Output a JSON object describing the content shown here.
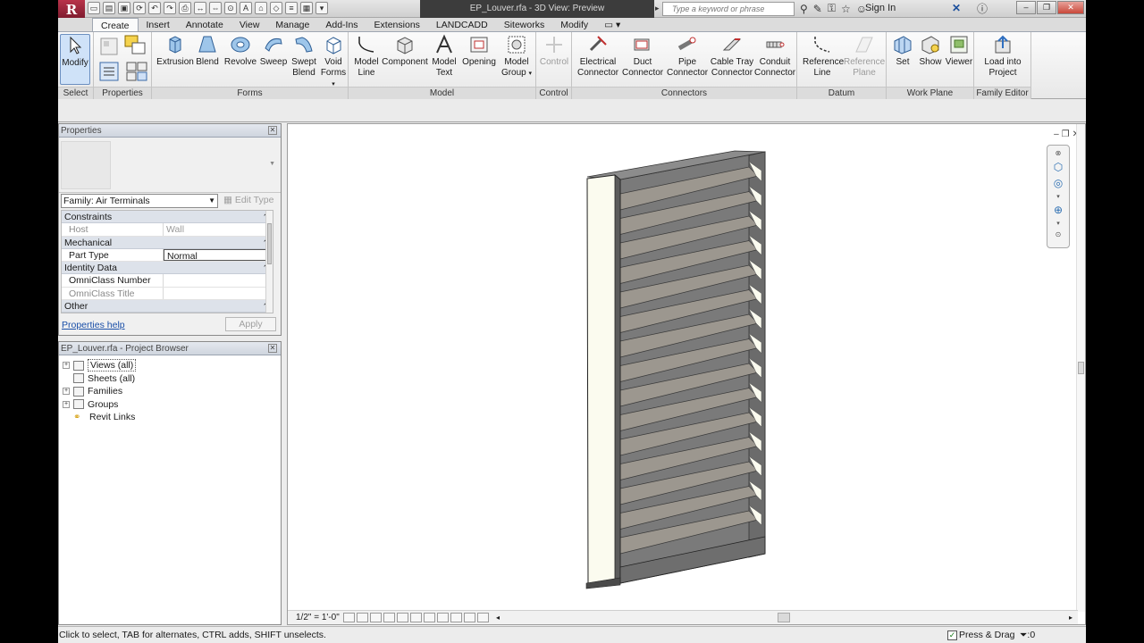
{
  "titlebar": {
    "app_menu_letter": "R",
    "doc_title": "EP_Louver.rfa - 3D View: Preview",
    "search_placeholder": "Type a keyword or phrase",
    "sign_in": "Sign In"
  },
  "ribbon": {
    "tabs": [
      "Create",
      "Insert",
      "Annotate",
      "View",
      "Manage",
      "Add-Ins",
      "Extensions",
      "LANDCADD",
      "Siteworks",
      "Modify"
    ],
    "panels": {
      "select": "Select",
      "properties": "Properties",
      "forms": "Forms",
      "model": "Model",
      "control": "Control",
      "connectors": "Connectors",
      "datum": "Datum",
      "work_plane": "Work Plane",
      "family_editor": "Family Editor"
    },
    "tools": {
      "modify": "Modify",
      "extrusion": "Extrusion",
      "blend": "Blend",
      "revolve": "Revolve",
      "sweep": "Sweep",
      "swept_blend_1": "Swept",
      "swept_blend_2": "Blend",
      "void_forms_1": "Void",
      "void_forms_2": "Forms",
      "model_line_1": "Model",
      "model_line_2": "Line",
      "component": "Component",
      "model_text_1": "Model",
      "model_text_2": "Text",
      "opening": "Opening",
      "model_group_1": "Model",
      "model_group_2": "Group",
      "control": "Control",
      "electrical_1": "Electrical",
      "electrical_2": "Connector",
      "duct_1": "Duct",
      "duct_2": "Connector",
      "pipe_1": "Pipe",
      "pipe_2": "Connector",
      "cable_tray_1": "Cable Tray",
      "cable_tray_2": "Connector",
      "conduit_1": "Conduit",
      "conduit_2": "Connector",
      "ref_line_1": "Reference",
      "ref_line_2": "Line",
      "ref_plane_1": "Reference",
      "ref_plane_2": "Plane",
      "set": "Set",
      "show": "Show",
      "viewer": "Viewer",
      "load_1": "Load into",
      "load_2": "Project"
    }
  },
  "properties": {
    "title": "Properties",
    "family_select": "Family: Air Terminals",
    "edit_type": "Edit Type",
    "groups": {
      "constraints": "Constraints",
      "mechanical": "Mechanical",
      "identity": "Identity Data",
      "other": "Other"
    },
    "rows": {
      "host_k": "Host",
      "host_v": "Wall",
      "part_type_k": "Part Type",
      "part_type_v": "Normal",
      "omni_num_k": "OmniClass Number",
      "omni_num_v": "",
      "omni_title_k": "OmniClass Title",
      "omni_title_v": ""
    },
    "help_link": "Properties help",
    "apply": "Apply"
  },
  "project_browser": {
    "title": "EP_Louver.rfa - Project Browser",
    "items": [
      "Views (all)",
      "Sheets (all)",
      "Families",
      "Groups",
      "Revit Links"
    ]
  },
  "view": {
    "scale": "1/2\" = 1'-0\"",
    "filter_count": ":0"
  },
  "status": {
    "text": "Click to select, TAB for alternates, CTRL adds, SHIFT unselects.",
    "press_drag": "Press & Drag"
  },
  "colors": {
    "louver_frame": "#6b6b6b",
    "louver_blade": "#9c978f",
    "louver_side": "#fbfbef",
    "app_button": "#9b2a3e"
  }
}
